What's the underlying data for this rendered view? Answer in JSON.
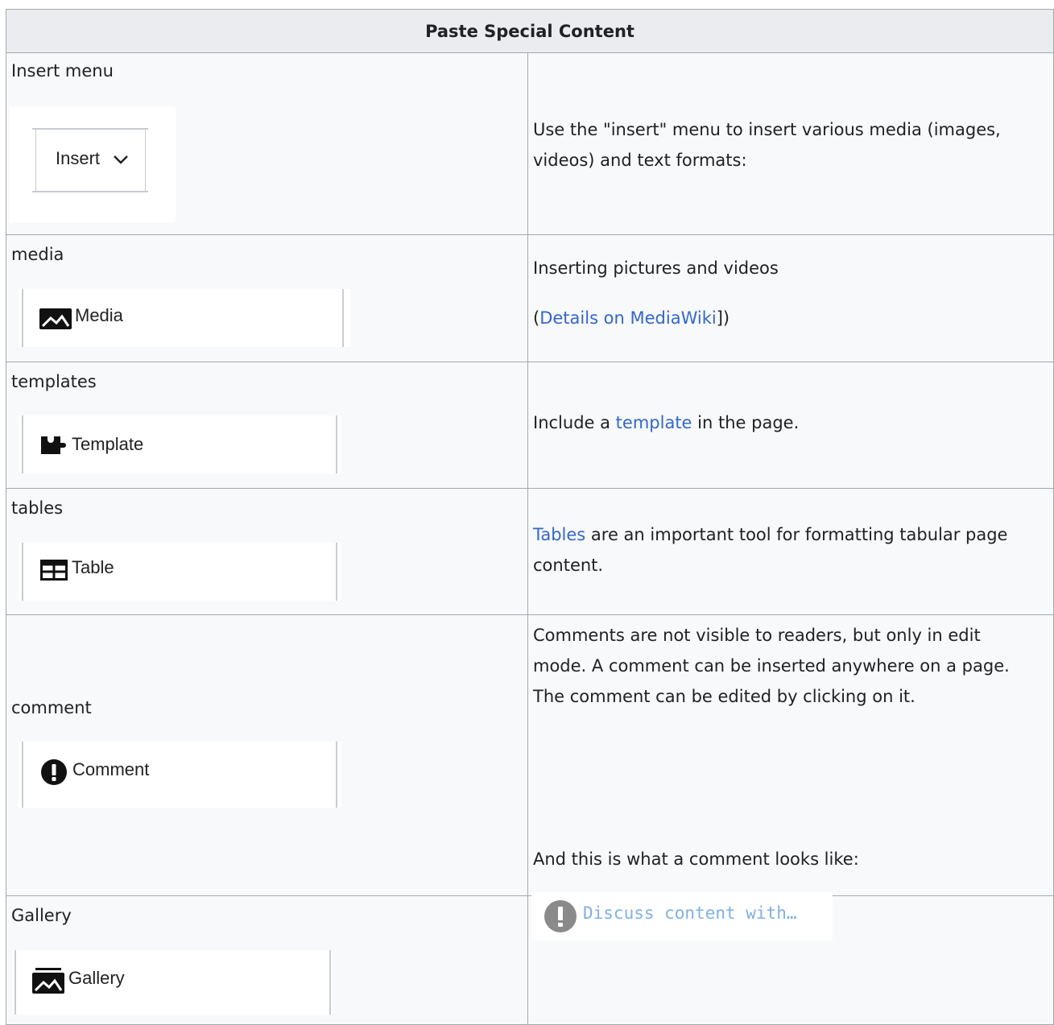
{
  "table": {
    "header": "Paste Special Content",
    "rows": [
      {
        "label": "Insert menu",
        "button": "Insert",
        "icon": "chevron-down-icon",
        "description": "Use the \"insert\" menu to insert various media (images, videos) and text formats:"
      },
      {
        "label": "media",
        "button": "Media",
        "icon": "image-icon",
        "description": "Inserting pictures and videos",
        "detail_open": "(",
        "detail_link": "Details on MediaWiki",
        "detail_close": "])"
      },
      {
        "label": "templates",
        "button": "Template",
        "icon": "puzzle-icon",
        "desc_before": "Include a ",
        "desc_link": "template",
        "desc_after": " in the page."
      },
      {
        "label": "tables",
        "button": "Table",
        "icon": "table-icon",
        "desc_link": "Tables",
        "desc_after": " are an important tool for formatting tabular page content."
      },
      {
        "label": "comment",
        "button": "Comment",
        "icon": "exclamation-icon",
        "description": "Comments are not visible to readers, but only in edit mode. A comment can be inserted anywhere on a page. The comment can be edited by clicking on it.",
        "description2": "And this is what a comment looks like:",
        "comment_example": "Discuss content with…"
      },
      {
        "label": "Gallery",
        "button": "Gallery",
        "icon": "gallery-icon"
      }
    ]
  }
}
